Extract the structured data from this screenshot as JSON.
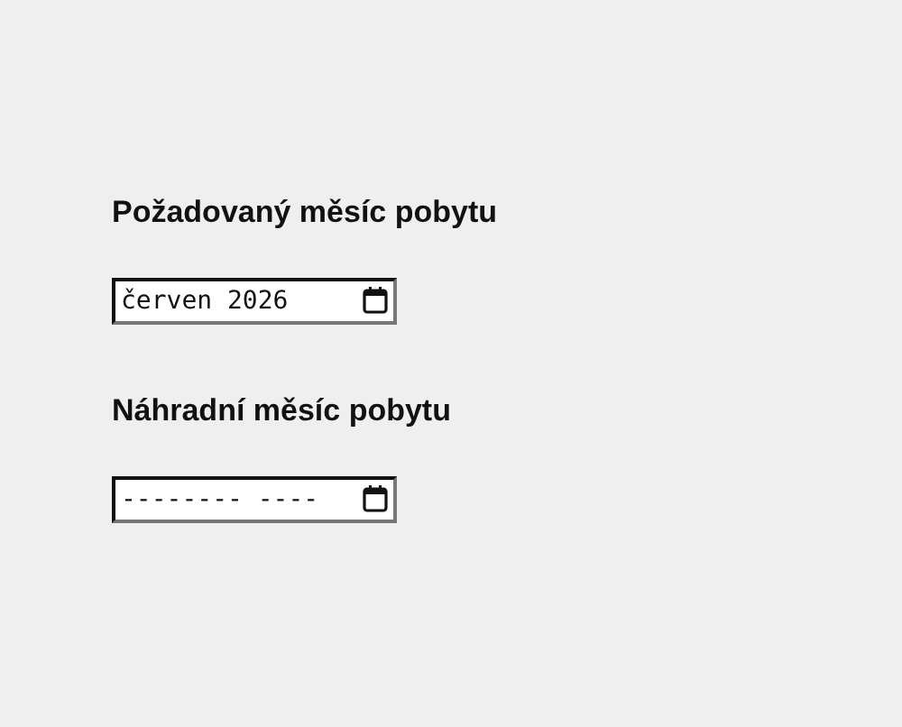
{
  "fields": [
    {
      "label": "Požadovaný měsíc pobytu",
      "value": "červen 2026"
    },
    {
      "label": "Náhradní měsíc pobytu",
      "placeholder": "-------- ----"
    }
  ]
}
